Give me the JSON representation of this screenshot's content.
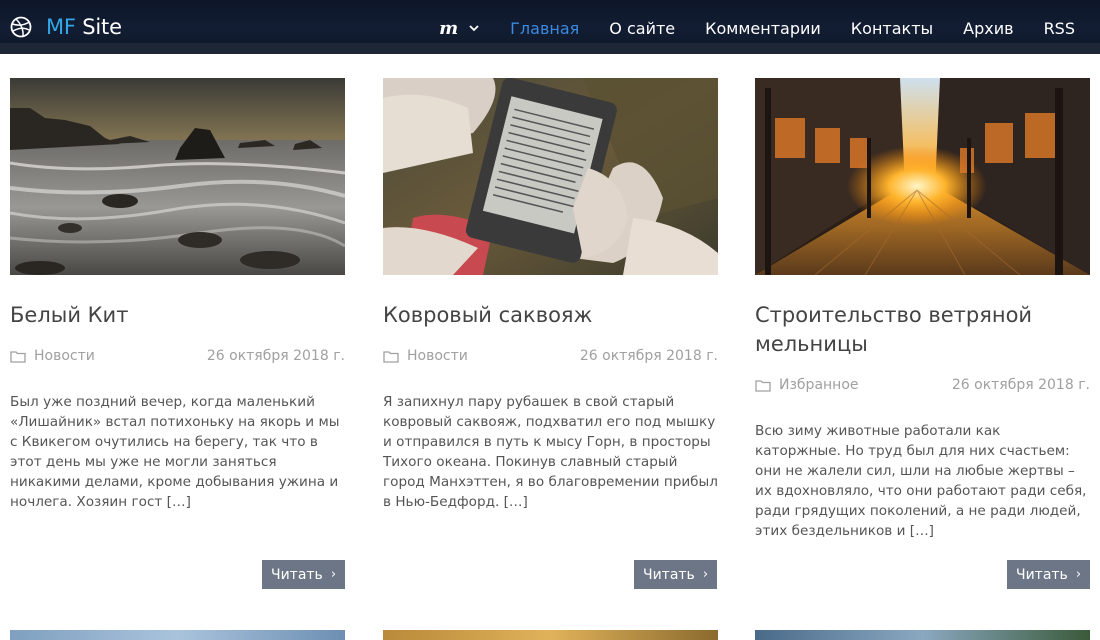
{
  "header": {
    "brand_prefix": "MF",
    "brand_suffix": " Site",
    "lang_logo": "m",
    "nav": [
      {
        "label": "Главная",
        "active": true
      },
      {
        "label": "О сайте",
        "active": false
      },
      {
        "label": "Комментарии",
        "active": false
      },
      {
        "label": "Контакты",
        "active": false
      },
      {
        "label": "Архив",
        "active": false
      },
      {
        "label": "RSS",
        "active": false
      }
    ]
  },
  "colors": {
    "header_bg": "#0f1a2e",
    "brand_accent": "#33a6e6",
    "nav_active": "#3b8ae0",
    "button_bg": "#6d7686"
  },
  "icons": {
    "brand": "dribbble-ball-icon",
    "lang_menu": "chevron-down-icon",
    "category": "folder-icon",
    "read_arrow": "chevron-right-icon"
  },
  "posts": [
    {
      "title": "Белый Кит",
      "category": "Новости",
      "date": "26 октября 2018 г.",
      "excerpt": "Был уже поздний вечер, когда маленький «Лишайник» встал потихоньку на якорь и мы с Квикегом очутились на берегу, так что в этот день мы уже не могли заняться никакими делами, кроме добывания ужина и ночлега. Хозяин гост",
      "more": "[…]",
      "read_label": "Читать",
      "image": "rocky-sea-shore"
    },
    {
      "title": "Ковровый саквояж",
      "category": "Новости",
      "date": "26 октября 2018 г.",
      "excerpt": "Я запихнул пару рубашек в свой старый ковровый саквояж, подхватил его под мышку и отправился в путь к мысу Горн, в просторы Тихого океана. Покинув славный старый город Манхэттен, я во благовремении прибыл в Нью-Бедфорд.",
      "more": "[…]",
      "read_label": "Читать",
      "image": "hand-holding-ereader"
    },
    {
      "title": "Строительство ветряной мельницы",
      "category": "Избранное",
      "date": "26 октября 2018 г.",
      "excerpt": "Всю зиму животные работали как каторжные. Но труд был для них счастьем: они не жалели сил, шли на любые жертвы – их вдохновляло, что они работают ради себя, ради грядущих поколений, а не ради людей, этих бездельников и",
      "more": "[…]",
      "read_label": "Читать",
      "image": "sunset-city-street"
    }
  ]
}
